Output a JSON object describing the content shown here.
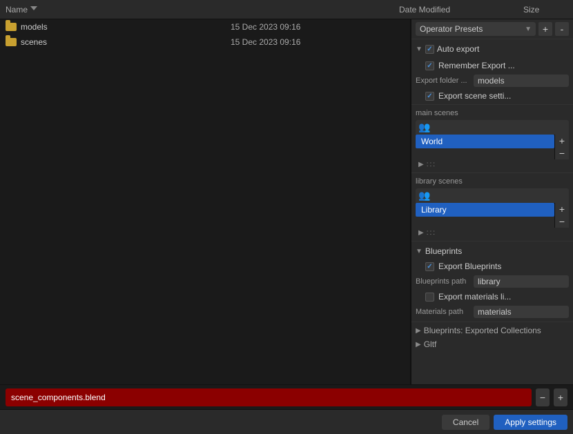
{
  "header": {
    "col_name": "Name",
    "col_date": "Date Modified",
    "col_size": "Size"
  },
  "files": [
    {
      "name": "models",
      "type": "folder",
      "date": "15 Dec 2023 09:16",
      "size": ""
    },
    {
      "name": "scenes",
      "type": "folder",
      "date": "15 Dec 2023 09:16",
      "size": ""
    }
  ],
  "right_panel": {
    "presets_label": "Operator Presets",
    "presets_add": "+",
    "presets_remove": "-",
    "auto_export_label": "Auto export",
    "remember_export_label": "Remember Export ...",
    "export_folder_label": "Export folder ...",
    "export_folder_value": "models",
    "export_scene_settings_label": "Export scene setti...",
    "main_scenes_label": "main scenes",
    "scenes_icon": "🎬",
    "main_scenes": [
      {
        "name": "World",
        "selected": true
      }
    ],
    "library_scenes_label": "library scenes",
    "library_scenes": [
      {
        "name": "Library",
        "selected": true
      }
    ],
    "blueprints_label": "Blueprints",
    "export_blueprints_label": "Export Blueprints",
    "blueprints_path_label": "Blueprints path",
    "blueprints_path_value": "library",
    "export_materials_label": "Export materials li...",
    "materials_path_label": "Materials path",
    "materials_path_value": "materials",
    "blueprints_exported_collections_label": "Blueprints: Exported Collections",
    "gltf_label": "Gltf",
    "add_btn": "+",
    "remove_btn": "-"
  },
  "bottom": {
    "filename": "scene_components.blend",
    "minus_label": "−",
    "plus_label": "+"
  },
  "dialog": {
    "cancel_label": "Cancel",
    "apply_label": "Apply settings"
  }
}
